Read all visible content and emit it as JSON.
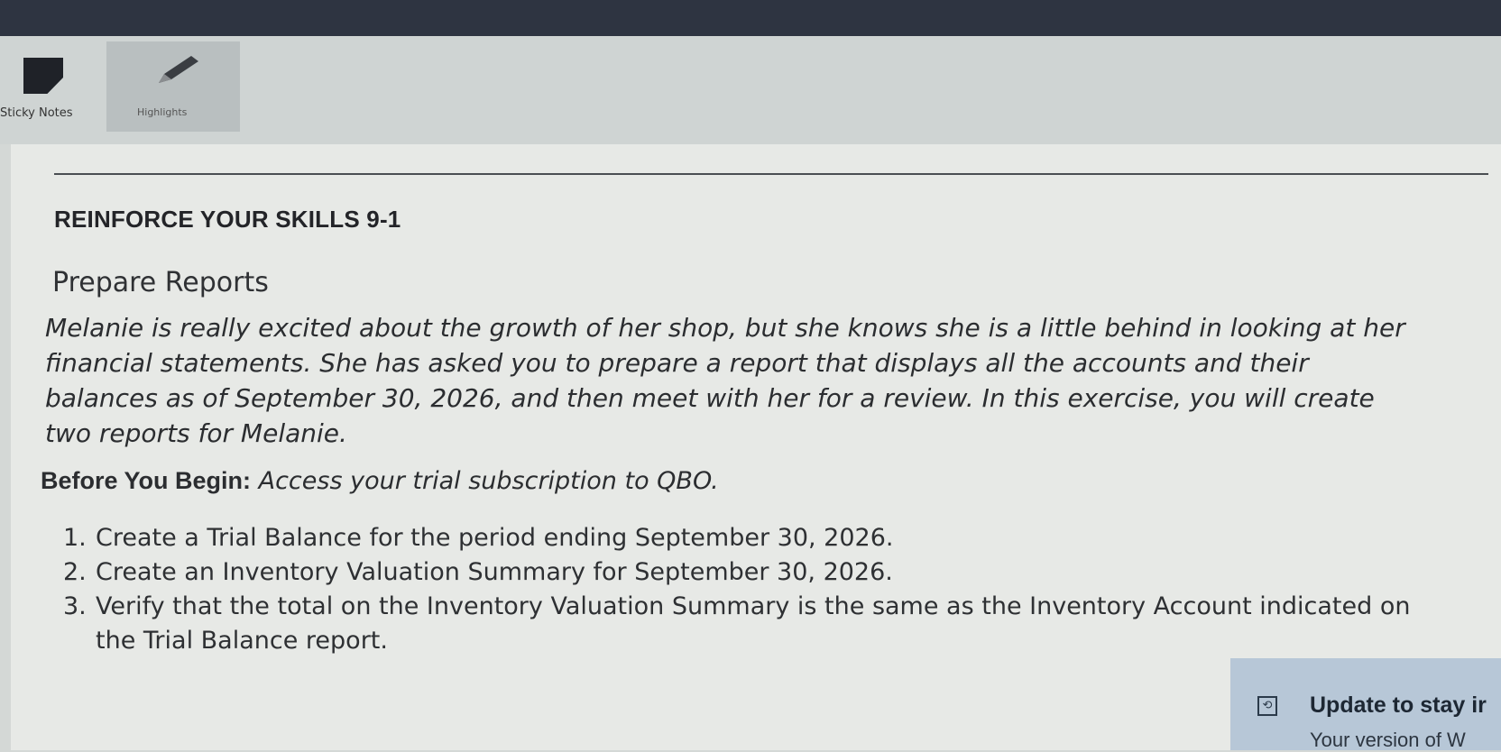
{
  "toolbar": {
    "sticky_notes_label": "Sticky Notes",
    "highlights_label": "Highlights"
  },
  "exercise": {
    "heading": "REINFORCE YOUR SKILLS 9-1",
    "subheading": "Prepare Reports",
    "intro": "Melanie is really excited about the growth of her shop, but she knows she is a little behind in looking at her financial statements. She has asked you to prepare a report that displays all the accounts and their balances as of September 30, 2026, and then meet with her for a review. In this exercise, you will create two reports for Melanie.",
    "before_label": "Before You Begin:",
    "before_text": " Access your trial subscription to QBO.",
    "steps": [
      {
        "num": "1.",
        "text": "Create a Trial Balance for the period ending September 30, 2026."
      },
      {
        "num": "2.",
        "text": "Create an Inventory Valuation Summary for September 30, 2026."
      },
      {
        "num": "3.",
        "text": "Verify that the total on the Inventory Valuation Summary is the same as the Inventory Account indicated on the Trial Balance report."
      }
    ]
  },
  "notification": {
    "icon": "update-icon",
    "title": "Update to stay ir",
    "subtitle": "Your version of W"
  }
}
